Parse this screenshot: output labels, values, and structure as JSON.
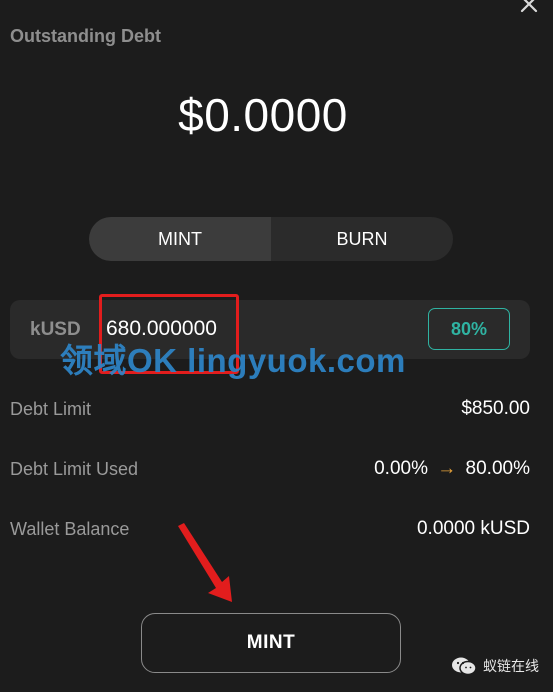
{
  "header": {
    "title": "Outstanding Debt",
    "amount": "$0.0000"
  },
  "mode_tabs": [
    {
      "label": "MINT",
      "active": true
    },
    {
      "label": "BURN",
      "active": false
    }
  ],
  "amount_field": {
    "currency": "kUSD",
    "value": "680.000000",
    "percent_label": "80%"
  },
  "info": {
    "debt_limit_label": "Debt Limit",
    "debt_limit_value": "$850.00",
    "debt_limit_used_label": "Debt Limit Used",
    "debt_limit_used_from": "0.00%",
    "debt_limit_used_arrow": "→",
    "debt_limit_used_to": "80.00%",
    "wallet_balance_label": "Wallet Balance",
    "wallet_balance_value": "0.0000 kUSD"
  },
  "action_button_label": "MINT",
  "overlay": {
    "watermark_text": "领域OK lingyuok.com",
    "corner_logo_text": "蚁链在线"
  },
  "colors": {
    "background": "#1c1c1c",
    "accent_teal": "#2fb3a2",
    "highlight_red": "#e21d1d",
    "arrow_orange": "#e8a33a",
    "watermark_blue": "#2e86c9"
  },
  "icons": {
    "close": "close-icon",
    "arrow": "right-arrow-icon",
    "annotation": "red-pointer-arrow-icon",
    "logo": "wechat-icon"
  }
}
